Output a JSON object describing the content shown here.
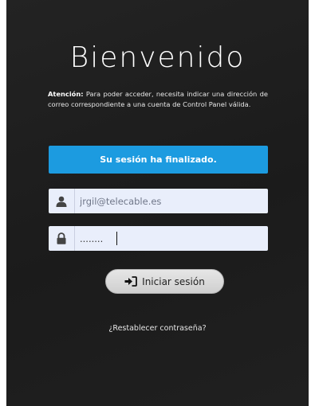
{
  "header": {
    "title": "Bienvenido"
  },
  "notice": {
    "label": "Atención:",
    "text": " Para poder acceder, necesita indicar una dirección de correo correspondiente a una cuenta de Control Panel válida."
  },
  "status": {
    "session_message": "Su sesión ha finalizado."
  },
  "form": {
    "email_value": "jrgil@telecable.es",
    "email_icon": "user-icon",
    "password_value": "........",
    "password_icon": "lock-icon",
    "login_label": "Iniciar sesión",
    "login_icon": "sign-in-icon",
    "reset_link": "¿Restablecer contraseña?"
  },
  "colors": {
    "panel_background": "#1e1e1e",
    "banner_blue": "#1c9be0",
    "input_background": "#e9eefb"
  }
}
